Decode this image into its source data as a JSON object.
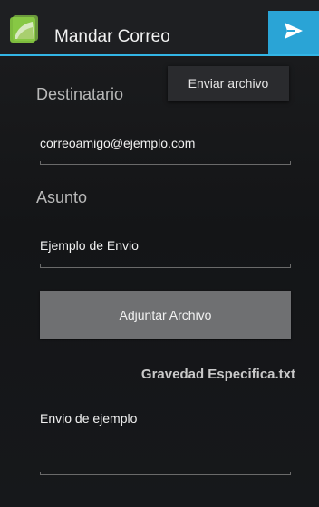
{
  "app": {
    "title": "Mandar Correo",
    "icon": "android-app-icon",
    "accent_color": "#33b5e5"
  },
  "action_bar": {
    "send_icon": "send-icon",
    "overflow_menu": {
      "items": [
        "Enviar archivo"
      ]
    }
  },
  "form": {
    "recipient_label": "Destinatario",
    "recipient_value": "correoamigo@ejemplo.com",
    "subject_label": "Asunto",
    "subject_value": "Ejemplo de Envio",
    "attach_button_label": "Adjuntar Archivo",
    "attached_file": "Gravedad Especifica.txt",
    "message_value": "Envio de ejemplo"
  }
}
